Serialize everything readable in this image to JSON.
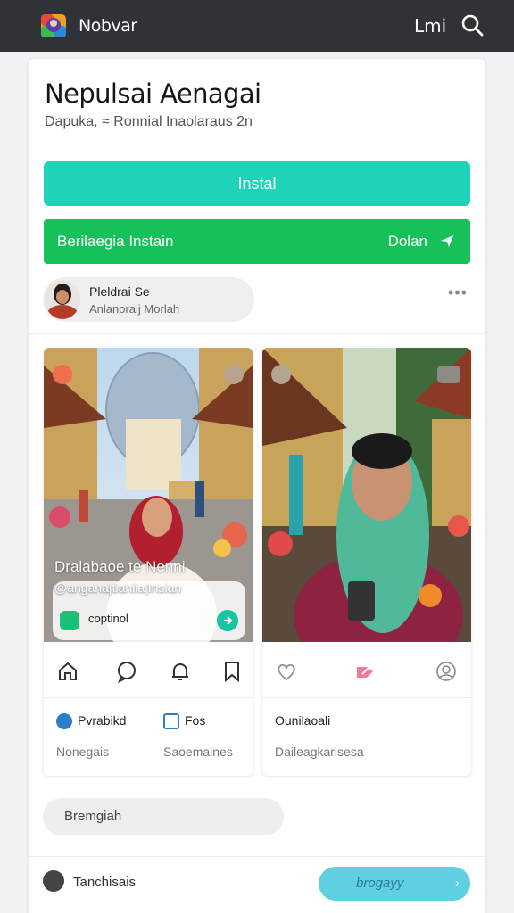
{
  "topbar": {
    "app_name": "Nobvar",
    "right_text": "Lmi"
  },
  "page": {
    "title": "Nepulsai Aenagai",
    "subtitle": "Dapuka, ≈ Ronnial Inaolaraus 2n"
  },
  "buttons": {
    "install": "Instal",
    "secondary_left": "Berilaegia Instain",
    "secondary_right": "Dolan"
  },
  "author": {
    "name": "Pleldrai Se",
    "sub": "Anlanoraij Morlah"
  },
  "posts": [
    {
      "overlay_title": "Dralabaoe te Nenni",
      "overlay_handle": "@angana|tiahiia|Insian",
      "pill_label": "coptinol",
      "meta_left": "Pvrabikd",
      "meta_right": "Fos",
      "meta_sub_left": "Nonegais",
      "meta_sub_right": "Saoemaines"
    },
    {
      "meta_title": "Ounilaoali",
      "meta_sub": "Daileagkarisesa"
    }
  ],
  "comment": {
    "placeholder": "Bremgiah"
  },
  "footer": {
    "label": "Tanchisais",
    "button": "brogayy"
  },
  "colors": {
    "topbar": "#2f3237",
    "install": "#1ed3b8",
    "green": "#16c15a",
    "pill_btn": "#5fd0e0"
  }
}
